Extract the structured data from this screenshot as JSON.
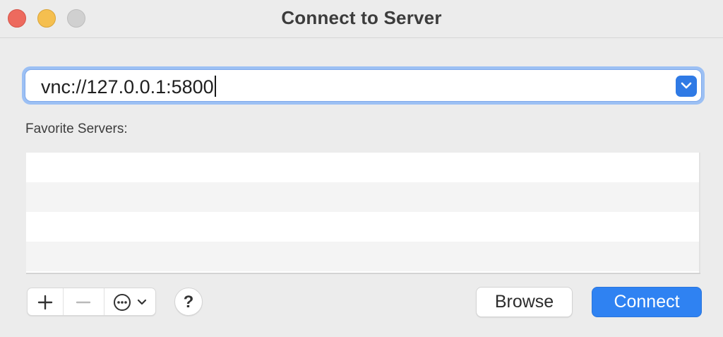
{
  "window": {
    "title": "Connect to Server"
  },
  "address": {
    "value": "vnc://127.0.0.1:5800"
  },
  "favorites": {
    "label": "Favorite Servers:",
    "rows": [
      "",
      "",
      "",
      ""
    ]
  },
  "controls": {
    "help_label": "?",
    "browse_label": "Browse",
    "connect_label": "Connect"
  },
  "icons": {
    "close": "close-traffic-light",
    "minimize": "minimize-traffic-light",
    "zoom": "zoom-traffic-light",
    "dropdown": "chevron-down-icon",
    "add": "plus-icon",
    "remove": "minus-icon",
    "more": "ellipsis-circle-icon"
  },
  "colors": {
    "accent": "#2f82f2",
    "close": "#ed6a5e",
    "minimize": "#f5bf4f",
    "zoom": "#d0d0d0"
  }
}
